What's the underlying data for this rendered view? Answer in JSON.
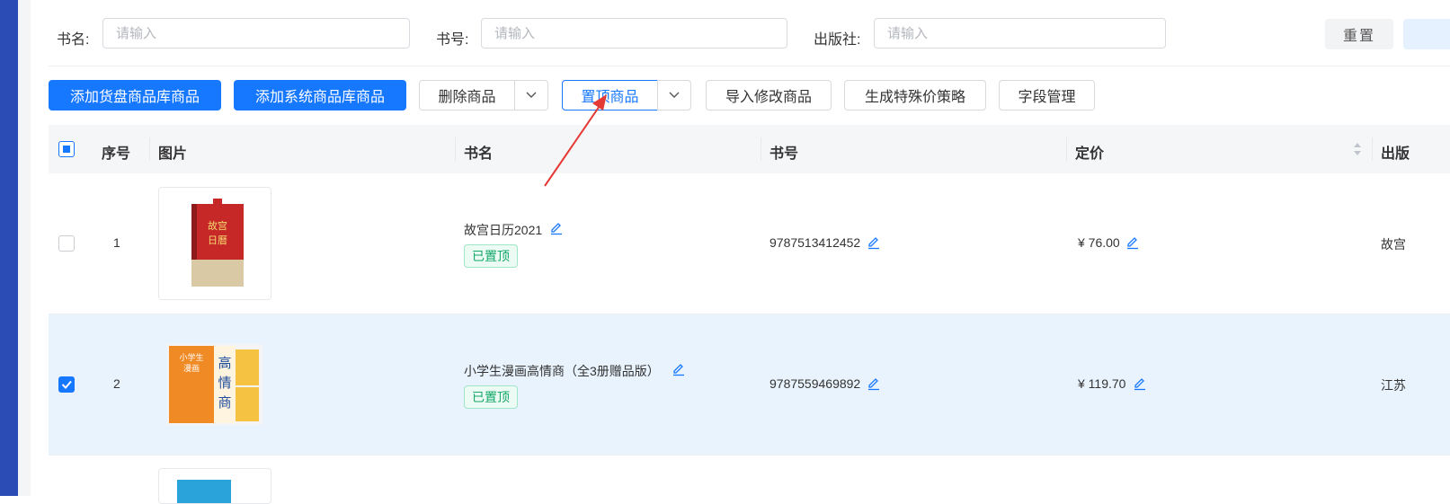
{
  "filters": {
    "book_name": {
      "label": "书名:",
      "placeholder": "请输入"
    },
    "isbn": {
      "label": "书号:",
      "placeholder": "请输入"
    },
    "publisher": {
      "label": "出版社:",
      "placeholder": "请输入"
    },
    "reset_label": "重置"
  },
  "toolbar": {
    "add_stock_label": "添加货盘商品库商品",
    "add_system_label": "添加系统商品库商品",
    "delete_label": "删除商品",
    "pin_label": "置顶商品",
    "import_label": "导入修改商品",
    "special_price_label": "生成特殊价策略",
    "field_manage_label": "字段管理"
  },
  "table": {
    "headers": {
      "index": "序号",
      "image": "图片",
      "title": "书名",
      "isbn": "书号",
      "price": "定价",
      "publisher": "出版"
    },
    "rows": [
      {
        "index": "1",
        "title": "故宫日历2021",
        "tag": "已置顶",
        "isbn": "9787513412452",
        "price": "¥ 76.00",
        "publisher": "故宫",
        "checked": false,
        "cover_title": "故宫日曆"
      },
      {
        "index": "2",
        "title": "小学生漫画高情商（全3册赠品版）",
        "tag": "已置顶",
        "isbn": "9787559469892",
        "price": "¥ 119.70",
        "publisher": "江苏",
        "checked": true,
        "cover_title": "高情商",
        "cover_subtitle": "小学生漫画"
      }
    ]
  },
  "colors": {
    "primary": "#1677ff",
    "tag_green": "#13a768",
    "annotation_arrow": "#e53935",
    "selected_row": "#e8f3fd"
  }
}
